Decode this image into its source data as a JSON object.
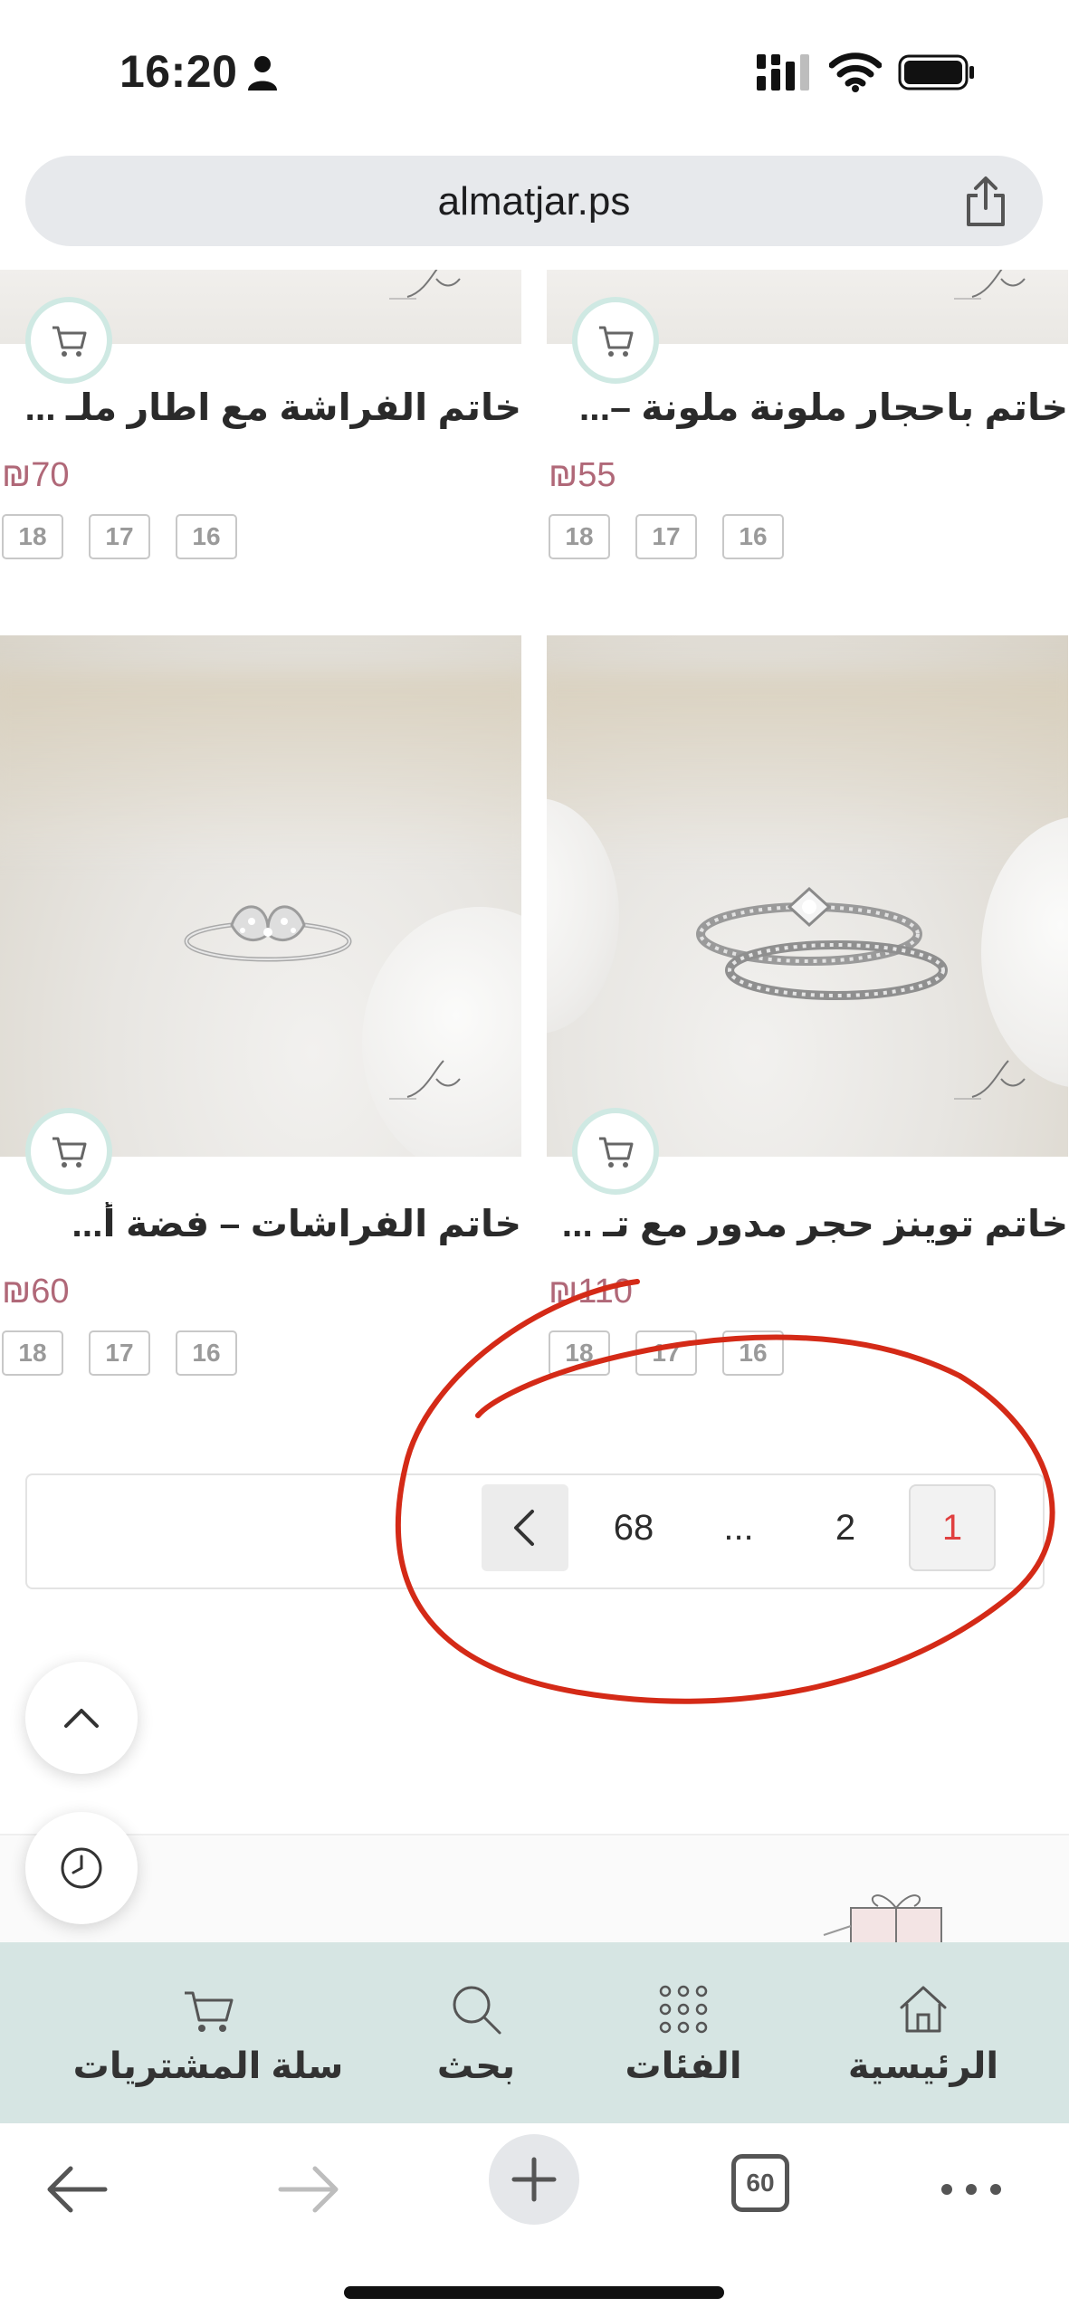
{
  "status_bar": {
    "time": "16:20"
  },
  "browser": {
    "url": "almatjar.ps",
    "tab_count": "60"
  },
  "products": [
    {
      "title": "خاتم الفراشة مع اطار ملـ ...",
      "price": "₪70",
      "sizes": [
        "18",
        "17",
        "16"
      ]
    },
    {
      "title": "خاتم باحجار ملونة ملونة –...",
      "price": "₪55",
      "sizes": [
        "18",
        "17",
        "16"
      ]
    },
    {
      "title": "خاتم الفراشات – فضة أ...",
      "price": "₪60",
      "sizes": [
        "18",
        "17",
        "16"
      ]
    },
    {
      "title": "خاتم توينز حجر مدور مع تـ ...",
      "price": "₪110",
      "sizes": [
        "18",
        "17",
        "16"
      ]
    }
  ],
  "pagination": {
    "last_page": "68",
    "ellipsis": "...",
    "page_2": "2",
    "current_page": "1"
  },
  "annotation": {
    "color": "#d42a17"
  },
  "bottom_nav": {
    "items": [
      {
        "label": "سلة المشتريات",
        "icon": "cart-icon"
      },
      {
        "label": "بحث",
        "icon": "search-icon"
      },
      {
        "label": "الفئات",
        "icon": "grid-icon"
      },
      {
        "label": "الرئيسية",
        "icon": "home-icon"
      }
    ]
  },
  "colors": {
    "price": "#b06878",
    "nav_background": "#d6e5e3",
    "cart_ring": "#cfe9e3",
    "current_page": "#e04040"
  }
}
